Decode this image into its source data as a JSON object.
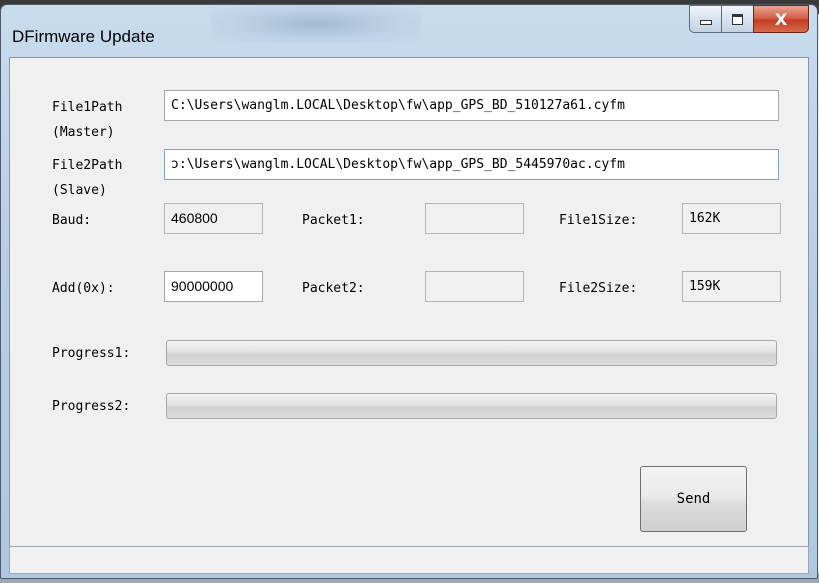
{
  "window": {
    "title": "DFirmware Update",
    "caption": {
      "minimize": "",
      "maximize": "",
      "close": "X"
    }
  },
  "form": {
    "file1_label": "File1Path",
    "file1_sub": "(Master)",
    "file1_value": "C:\\Users\\wanglm.LOCAL\\Desktop\\fw\\app_GPS_BD_510127a61.cyfm",
    "file2_label": "File2Path",
    "file2_sub": "(Slave)",
    "file2_value": "ɔ:\\Users\\wanglm.LOCAL\\Desktop\\fw\\app_GPS_BD_5445970ac.cyfm",
    "baud_label": "Baud:",
    "baud_value": "460800",
    "add_label": "Add(0x):",
    "add_value": "90000000",
    "packet1_label": "Packet1:",
    "packet1_value": "",
    "packet2_label": "Packet2:",
    "packet2_value": "",
    "file1size_label": "File1Size:",
    "file1size_value": "162K",
    "file2size_label": "File2Size:",
    "file2size_value": "159K",
    "progress1_label": "Progress1:",
    "progress1_value": 0,
    "progress2_label": "Progress2:",
    "progress2_value": 0,
    "send_label": "Send"
  },
  "status_text": ""
}
